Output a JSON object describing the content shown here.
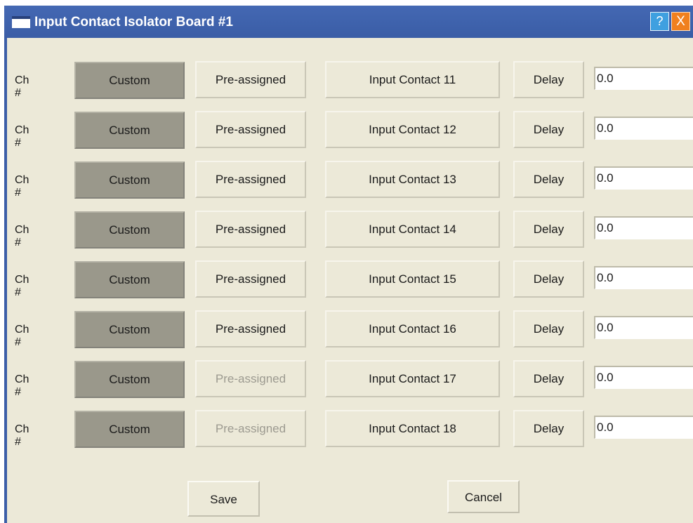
{
  "window": {
    "title": "Input Contact Isolator Board #1",
    "help_label": "?",
    "close_label": "X"
  },
  "rows": [
    {
      "ch_label": "Ch #",
      "custom_label": "Custom",
      "preassigned_label": "Pre-assigned",
      "preassigned_enabled": true,
      "contact_label": "Input Contact 11",
      "delay_label": "Delay",
      "delay_value": "0.0"
    },
    {
      "ch_label": "Ch #",
      "custom_label": "Custom",
      "preassigned_label": "Pre-assigned",
      "preassigned_enabled": true,
      "contact_label": "Input Contact 12",
      "delay_label": "Delay",
      "delay_value": "0.0"
    },
    {
      "ch_label": "Ch #",
      "custom_label": "Custom",
      "preassigned_label": "Pre-assigned",
      "preassigned_enabled": true,
      "contact_label": "Input Contact 13",
      "delay_label": "Delay",
      "delay_value": "0.0"
    },
    {
      "ch_label": "Ch #",
      "custom_label": "Custom",
      "preassigned_label": "Pre-assigned",
      "preassigned_enabled": true,
      "contact_label": "Input Contact 14",
      "delay_label": "Delay",
      "delay_value": "0.0"
    },
    {
      "ch_label": "Ch #",
      "custom_label": "Custom",
      "preassigned_label": "Pre-assigned",
      "preassigned_enabled": true,
      "contact_label": "Input Contact 15",
      "delay_label": "Delay",
      "delay_value": "0.0"
    },
    {
      "ch_label": "Ch #",
      "custom_label": "Custom",
      "preassigned_label": "Pre-assigned",
      "preassigned_enabled": true,
      "contact_label": "Input Contact 16",
      "delay_label": "Delay",
      "delay_value": "0.0"
    },
    {
      "ch_label": "Ch #",
      "custom_label": "Custom",
      "preassigned_label": "Pre-assigned",
      "preassigned_enabled": false,
      "contact_label": "Input Contact 17",
      "delay_label": "Delay",
      "delay_value": "0.0"
    },
    {
      "ch_label": "Ch #",
      "custom_label": "Custom",
      "preassigned_label": "Pre-assigned",
      "preassigned_enabled": false,
      "contact_label": "Input Contact 18",
      "delay_label": "Delay",
      "delay_value": "0.0"
    }
  ],
  "footer": {
    "save_label": "Save",
    "cancel_label": "Cancel"
  },
  "colors": {
    "titlebar": "#3b5ea8",
    "client_bg": "#ece9d8",
    "custom_selected": "#9a988b",
    "help_button": "#3fa0e0",
    "close_button": "#f0801e",
    "disabled_text": "#9c9a90"
  },
  "icons": {
    "title_icon": "window-icon",
    "help_icon": "help-icon",
    "close_icon": "close-icon"
  }
}
